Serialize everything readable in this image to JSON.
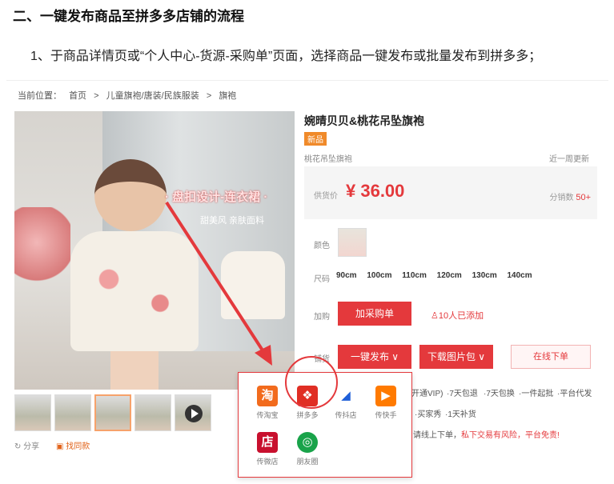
{
  "heading": "二、一键发布商品至拼多多店铺的流程",
  "step1": "1、于商品详情页或“个人中心-货源-采购单”页面，选择商品一键发布或批量发布到拼多多；",
  "breadcrumb": [
    "当前位置：",
    "首页",
    ">",
    "儿童旗袍/唐装/民族服装",
    ">",
    "旗袍"
  ],
  "image_promo": "· 盘扣设计-连衣裙 ·",
  "image_promo2": "甜美风  亲肤面料",
  "share": "分享",
  "find_same": "找同款",
  "product": {
    "title": "婉晴贝贝&桃花吊坠旗袍",
    "tag": "新品",
    "subname": "桃花吊坠旗袍",
    "updated": "近一周更新",
    "price_label": "供货价",
    "price": "¥ 36.00",
    "sold_label": "分销数",
    "sold_value": "50+"
  },
  "rows": {
    "color_label": "颜色",
    "size_label": "尺码",
    "sizes": [
      "90cm",
      "100cm",
      "110cm",
      "120cm",
      "130cm",
      "140cm"
    ],
    "buy_label": "加购",
    "add_cart": "加采购单",
    "added_count": "10人已添加",
    "shop_label": "铺货",
    "one_click": "一键发布 ∨",
    "download": "下载图片包 ∨",
    "online_order": "在线下单"
  },
  "services_partial": [
    "开通VIP)",
    "·7天包退",
    "·7天包换",
    "·一件起批",
    "·平台代发",
    "·买家秀",
    "·1天补货"
  ],
  "notice_partial": "请线上下单，",
  "notice_red": "私下交易有风险，平台免责!",
  "popup": [
    {
      "label": "传淘宝",
      "glyph": "淘",
      "color": "#f26b1d"
    },
    {
      "label": "拼多多",
      "glyph": "❖",
      "color": "#e02e24"
    },
    {
      "label": "传抖店",
      "glyph": "◢",
      "color": "#1f5fd8"
    },
    {
      "label": "传快手",
      "glyph": "▶",
      "color": "#ff7a00"
    },
    {
      "label": "传微店",
      "glyph": "店",
      "color": "#c8102e"
    },
    {
      "label": "朋友圈",
      "glyph": "◎",
      "color": "#19a34a"
    }
  ]
}
